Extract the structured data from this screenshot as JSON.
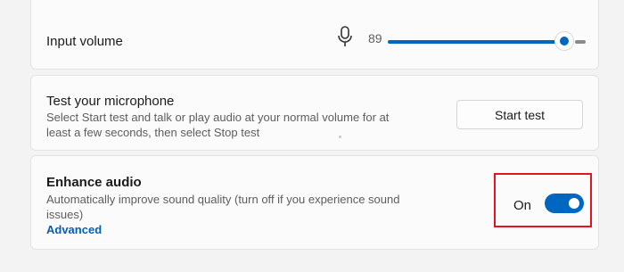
{
  "input_volume": {
    "label": "Input volume",
    "icon": "microphone-icon",
    "value_text": "89",
    "level": 0.89
  },
  "mic_test": {
    "title": "Test your microphone",
    "description": "Select Start test and talk or play audio at your normal volume for at least a few seconds, then select Stop test",
    "button_label": "Start test"
  },
  "enhance_audio": {
    "title": "Enhance audio",
    "description": "Automatically improve sound quality (turn off if you experience sound issues)",
    "link_label": "Advanced",
    "toggle_state_label": "On",
    "toggle_on": true
  },
  "colors": {
    "accent": "#0067c0",
    "link": "#005fb8",
    "highlight_box": "#e3141b",
    "background": "#f3f3f3",
    "card": "#fbfbfb"
  }
}
